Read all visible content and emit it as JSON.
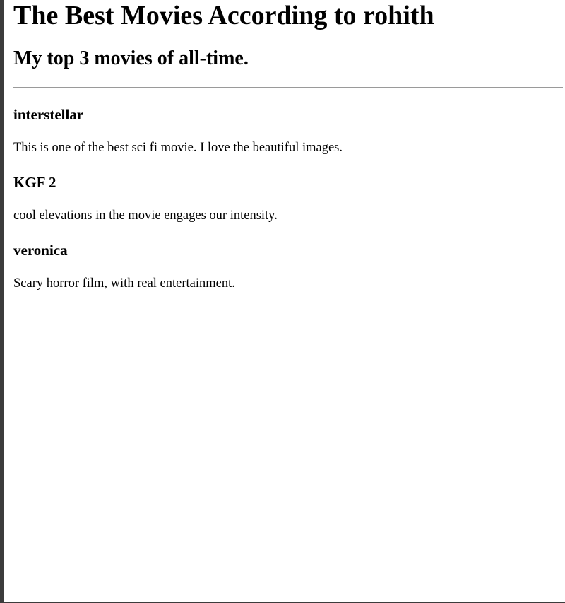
{
  "page": {
    "title": "The Best Movies According to rohith",
    "subtitle": "My top 3 movies of all-time."
  },
  "movies": [
    {
      "title": "interstellar",
      "review": "This is one of the best sci fi movie. I love the beautiful images."
    },
    {
      "title": "KGF 2",
      "review": "cool elevations in the movie engages our intensity."
    },
    {
      "title": "veronica",
      "review": "Scary horror film, with real entertainment."
    }
  ]
}
